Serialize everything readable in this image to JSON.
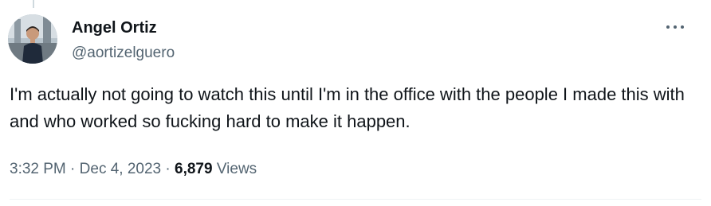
{
  "tweet": {
    "author": {
      "name": "Angel Ortiz",
      "handle": "@aortizelguero",
      "avatar_icon": "profile-photo"
    },
    "more_icon": "more-horizontal-icon",
    "text": "I'm actually not going to watch this until I'm in the office with the people I made this with and who worked so fucking hard to make it happen.",
    "time": "3:32 PM",
    "separator": "·",
    "date": "Dec 4, 2023",
    "views_count": "6,879",
    "views_label": "Views"
  },
  "colors": {
    "text_primary": "#0f1419",
    "text_secondary": "#536471",
    "divider": "#eff3f4"
  }
}
